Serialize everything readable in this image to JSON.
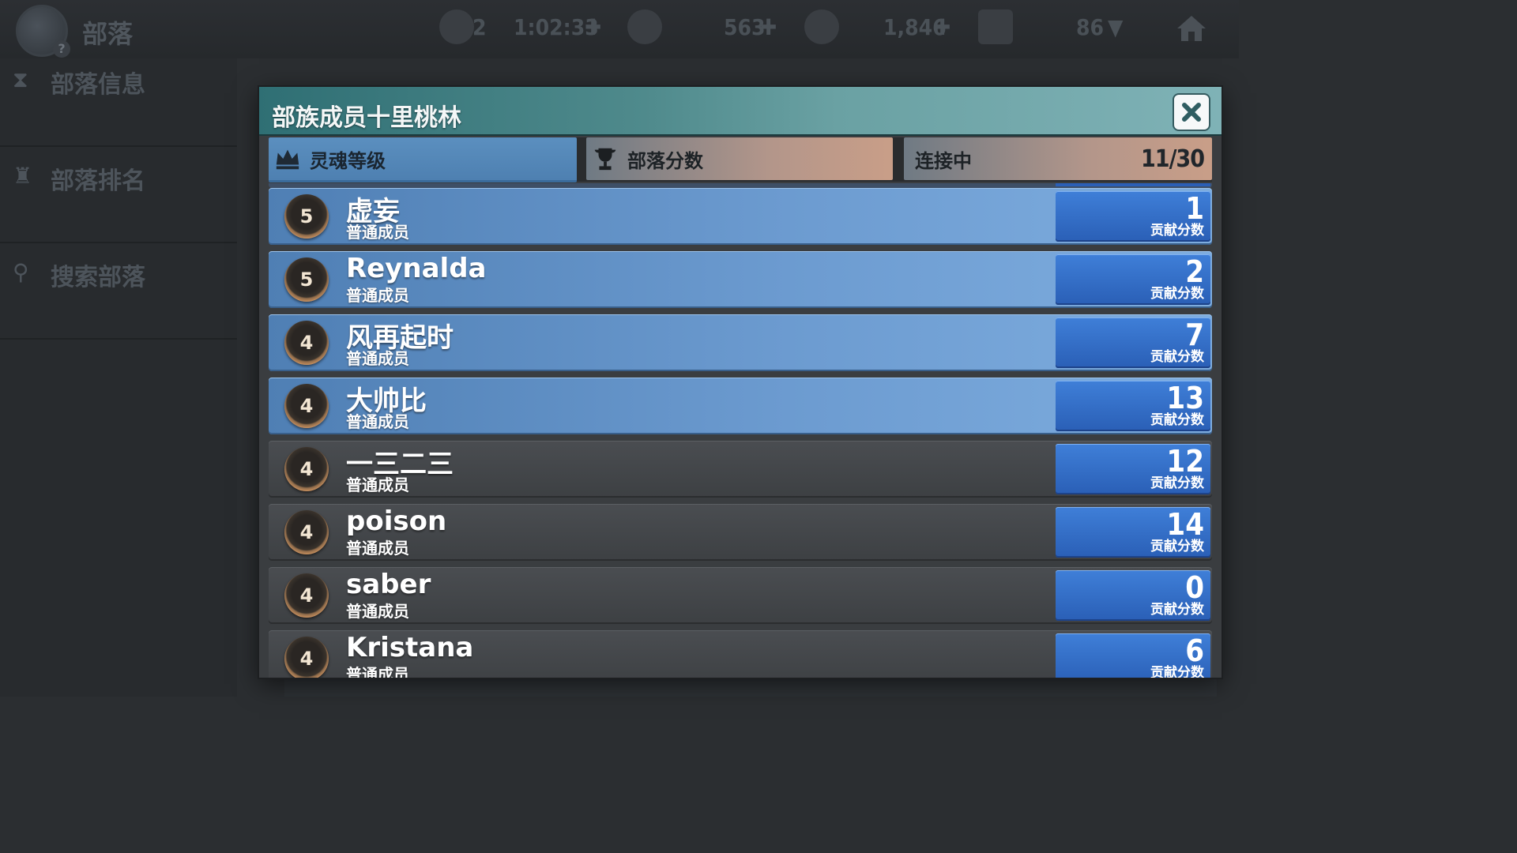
{
  "topbar": {
    "title": "部落",
    "timer_count": "2",
    "timer_value": "1:02:33",
    "resource_1": "563",
    "resource_2": "1,846",
    "trophy_value": "86"
  },
  "sidebar": {
    "items": [
      {
        "label": "部落信息"
      },
      {
        "label": "部落排名"
      },
      {
        "label": "搜索部落"
      }
    ]
  },
  "modal": {
    "title": "部族成员十里桃林",
    "tabs": [
      {
        "label": "灵魂等级",
        "active": true
      },
      {
        "label": "部落分数",
        "active": false
      },
      {
        "label": "连接中",
        "active": false
      }
    ],
    "member_count": "11/30",
    "members": [
      {
        "level": "5",
        "name": "虚妄",
        "role": "普通成员",
        "score": "1",
        "score_label": "贡献分数",
        "highlight": true
      },
      {
        "level": "5",
        "name": "Reynalda",
        "role": "普通成员",
        "score": "2",
        "score_label": "贡献分数",
        "highlight": true
      },
      {
        "level": "4",
        "name": "风再起时",
        "role": "普通成员",
        "score": "7",
        "score_label": "贡献分数",
        "highlight": true
      },
      {
        "level": "4",
        "name": "大帅比",
        "role": "普通成员",
        "score": "13",
        "score_label": "贡献分数",
        "highlight": true
      },
      {
        "level": "4",
        "name": "一三二三",
        "role": "普通成员",
        "score": "12",
        "score_label": "贡献分数",
        "highlight": false
      },
      {
        "level": "4",
        "name": "poison",
        "role": "普通成员",
        "score": "14",
        "score_label": "贡献分数",
        "highlight": false
      },
      {
        "level": "4",
        "name": "saber",
        "role": "普通成员",
        "score": "0",
        "score_label": "贡献分数",
        "highlight": false
      },
      {
        "level": "4",
        "name": "Kristana",
        "role": "普通成员",
        "score": "6",
        "score_label": "贡献分数",
        "highlight": false
      }
    ]
  },
  "icons": {
    "close": "close-icon",
    "soul_level": "crown-icon",
    "tribe_score": "trophy-icon"
  }
}
